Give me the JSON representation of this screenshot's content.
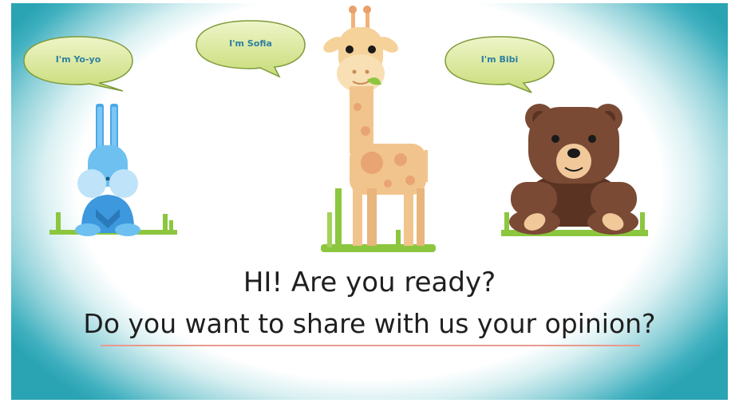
{
  "speech_bubbles": {
    "rabbit": "I'm Yo-yo",
    "giraffe": "I'm Sofia",
    "bear": "I'm Bibi"
  },
  "heading": {
    "line1": "HI! Are you ready?",
    "line2": "Do you want to share with us your opinion?"
  },
  "colors": {
    "bubble_fill": "#d7e89a",
    "bubble_text": "#2e7fa0",
    "grass": "#8cc63f",
    "rabbit": "#4aa8e8",
    "giraffe": "#f2c48d",
    "bear": "#7a4a35",
    "underline": "#e8998e",
    "frame_teal": "#2aa3b3"
  }
}
